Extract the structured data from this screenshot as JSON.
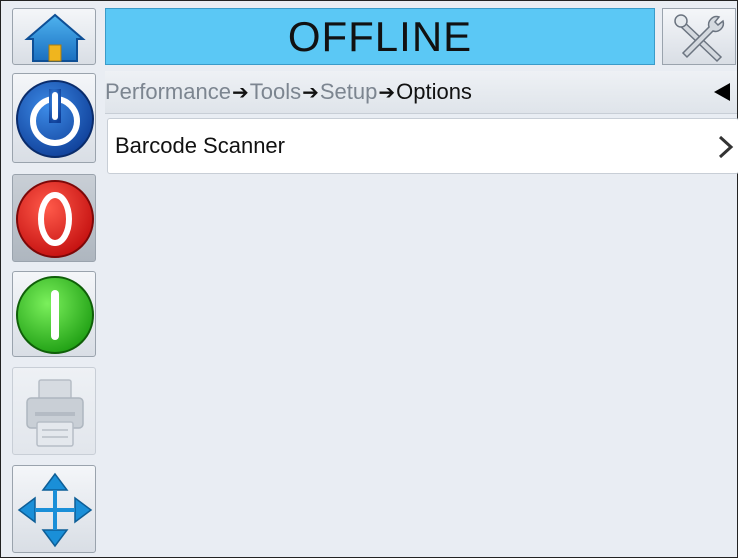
{
  "header": {
    "status_text": "OFFLINE"
  },
  "breadcrumb": {
    "items": [
      "Performance",
      "Tools",
      "Setup",
      "Options"
    ],
    "separator": "➔"
  },
  "main": {
    "items": [
      {
        "label": "Barcode Scanner"
      }
    ]
  },
  "sidebar": {
    "buttons": [
      {
        "icon": "home-icon"
      },
      {
        "icon": "power-icon",
        "color": "#1e5fbf"
      },
      {
        "icon": "stop-icon",
        "color": "#e21d1d"
      },
      {
        "icon": "start-icon",
        "color": "#2fbf1e"
      },
      {
        "icon": "printer-icon"
      },
      {
        "icon": "navigation-arrows-icon",
        "color": "#1a8fd8"
      }
    ]
  },
  "colors": {
    "status_bar": "#5bc8f5",
    "background": "#e9edf3"
  }
}
